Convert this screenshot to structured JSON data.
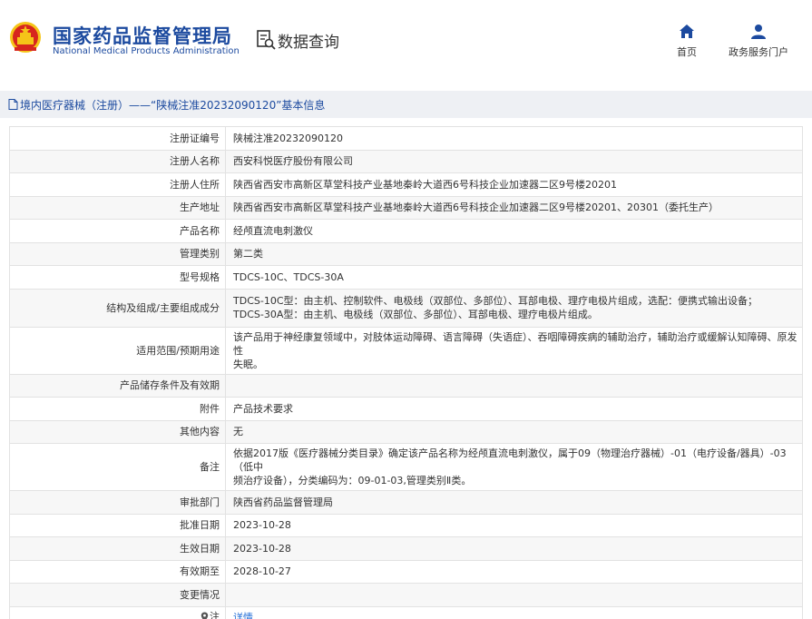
{
  "header": {
    "logo_cn": "国家药品监督管理局",
    "logo_en": "National Medical Products Administration",
    "data_query_label": "数据查询",
    "nav": [
      {
        "label": "首页",
        "icon": "home-icon"
      },
      {
        "label": "政务服务门户",
        "icon": "user-icon"
      }
    ]
  },
  "breadcrumb": {
    "text": "境内医疗器械（注册）——“陕械注准20232090120”基本信息"
  },
  "details": {
    "reg_no": {
      "label": "注册证编号",
      "value": "陕械注准20232090120"
    },
    "registrant": {
      "label": "注册人名称",
      "value": "西安科悦医疗股份有限公司"
    },
    "registrant_address": {
      "label": "注册人住所",
      "value": "陕西省西安市高新区草堂科技产业基地秦岭大道西6号科技企业加速器二区9号楼20201"
    },
    "production_address": {
      "label": "生产地址",
      "value": "陕西省西安市高新区草堂科技产业基地秦岭大道西6号科技企业加速器二区9号楼20201、20301（委托生产）"
    },
    "product_name": {
      "label": "产品名称",
      "value": "经颅直流电刺激仪"
    },
    "management_class": {
      "label": "管理类别",
      "value": "第二类"
    },
    "models": {
      "label": "型号规格",
      "value": "TDCS-10C、TDCS-30A"
    },
    "structure": {
      "label": "结构及组成/主要组成成分",
      "line1": "TDCS-10C型：由主机、控制软件、电极线（双部位、多部位）、耳部电极、理疗电极片组成，选配：便携式输出设备；",
      "line2": "TDCS-30A型：由主机、电极线（双部位、多部位）、耳部电极、理疗电极片组成。"
    },
    "scope": {
      "label": "适用范围/预期用途",
      "line1": "该产品用于神经康复领域中，对肢体运动障碍、语言障碍（失语症）、吞咽障碍疾病的辅助治疗，辅助治疗或缓解认知障碍、原发性",
      "line2": "失眠。"
    },
    "storage": {
      "label": "产品储存条件及有效期",
      "value": ""
    },
    "attachment": {
      "label": "附件",
      "value": "产品技术要求"
    },
    "other": {
      "label": "其他内容",
      "value": "无"
    },
    "remark": {
      "label": "备注",
      "line1": "依据2017版《医疗器械分类目录》确定该产品名称为经颅直流电刺激仪，属于09（物理治疗器械）-01（电疗设备/器具）-03（低中",
      "line2": "频治疗设备），分类编码为：09-01-03,管理类别Ⅱ类。"
    },
    "approval_dept": {
      "label": "审批部门",
      "value": "陕西省药品监督管理局"
    },
    "approval_date": {
      "label": "批准日期",
      "value": "2023-10-28"
    },
    "effective_date": {
      "label": "生效日期",
      "value": "2023-10-28"
    },
    "expiry_date": {
      "label": "有效期至",
      "value": "2028-10-27"
    },
    "change_info": {
      "label": "变更情况",
      "value": ""
    },
    "note": {
      "label": "注",
      "link": "详情"
    }
  },
  "colors": {
    "brand_blue": "#1c4a9f",
    "link_blue": "#1c6ad6",
    "emblem_red": "#d7261e",
    "emblem_gold": "#f5c518"
  }
}
